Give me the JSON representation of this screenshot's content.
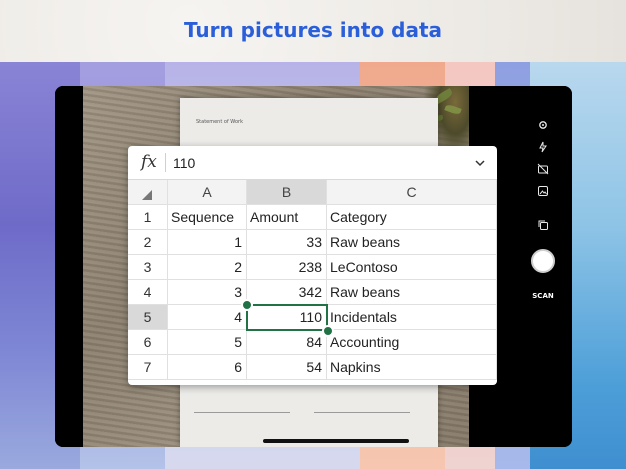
{
  "headline": {
    "text": "Turn pictures into data",
    "color": "#2b5fd9"
  },
  "document": {
    "title": "Statement of Work"
  },
  "formula_bar": {
    "fx_label": "fx",
    "value": "110"
  },
  "spreadsheet": {
    "columns": [
      "A",
      "B",
      "C"
    ],
    "selected_column": "B",
    "selected_row": "5",
    "rows": [
      {
        "num": "1",
        "a": "Sequence",
        "b": "Amount",
        "c": "Category"
      },
      {
        "num": "2",
        "a": "1",
        "b": "33",
        "c": "Raw beans"
      },
      {
        "num": "3",
        "a": "2",
        "b": "238",
        "c": "LeContoso"
      },
      {
        "num": "4",
        "a": "3",
        "b": "342",
        "c": "Raw beans"
      },
      {
        "num": "5",
        "a": "4",
        "b": "110",
        "c": "Incidentals"
      },
      {
        "num": "6",
        "a": "5",
        "b": "84",
        "c": "Accounting"
      },
      {
        "num": "7",
        "a": "6",
        "b": "54",
        "c": "Napkins"
      }
    ],
    "accent_color": "#217346"
  },
  "camera_toolbar": {
    "icons": [
      "settings-icon",
      "flash-icon",
      "no-camera-icon",
      "image-icon",
      "copy-icon"
    ],
    "scan_label": "SCAN"
  }
}
